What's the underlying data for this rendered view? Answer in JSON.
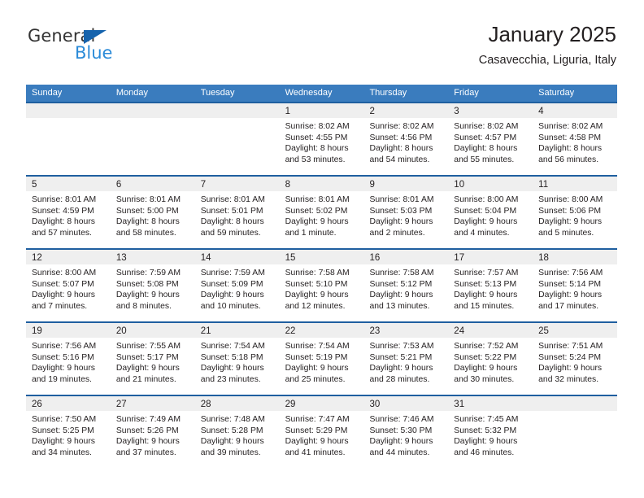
{
  "brand": {
    "name_top": "General",
    "name_bottom": "Blue",
    "triangle_color": "#1563ad",
    "blue_color": "#2b8bd8"
  },
  "header": {
    "title": "January 2025",
    "subtitle": "Casavecchia, Liguria, Italy"
  },
  "theme": {
    "header_blue": "#3a7cbe",
    "row_border_blue": "#1f5fa0",
    "daynum_strip": "#efefef"
  },
  "labels": {
    "sunrise": "Sunrise:",
    "sunset": "Sunset:",
    "daylight": "Daylight:"
  },
  "weekdays": [
    "Sunday",
    "Monday",
    "Tuesday",
    "Wednesday",
    "Thursday",
    "Friday",
    "Saturday"
  ],
  "weeks": [
    [
      {
        "day": "",
        "empty": true
      },
      {
        "day": "",
        "empty": true
      },
      {
        "day": "",
        "empty": true
      },
      {
        "day": "1",
        "sunrise": "Sunrise: 8:02 AM",
        "sunset": "Sunset: 4:55 PM",
        "daylight1": "Daylight: 8 hours",
        "daylight2": "and 53 minutes."
      },
      {
        "day": "2",
        "sunrise": "Sunrise: 8:02 AM",
        "sunset": "Sunset: 4:56 PM",
        "daylight1": "Daylight: 8 hours",
        "daylight2": "and 54 minutes."
      },
      {
        "day": "3",
        "sunrise": "Sunrise: 8:02 AM",
        "sunset": "Sunset: 4:57 PM",
        "daylight1": "Daylight: 8 hours",
        "daylight2": "and 55 minutes."
      },
      {
        "day": "4",
        "sunrise": "Sunrise: 8:02 AM",
        "sunset": "Sunset: 4:58 PM",
        "daylight1": "Daylight: 8 hours",
        "daylight2": "and 56 minutes."
      }
    ],
    [
      {
        "day": "5",
        "sunrise": "Sunrise: 8:01 AM",
        "sunset": "Sunset: 4:59 PM",
        "daylight1": "Daylight: 8 hours",
        "daylight2": "and 57 minutes."
      },
      {
        "day": "6",
        "sunrise": "Sunrise: 8:01 AM",
        "sunset": "Sunset: 5:00 PM",
        "daylight1": "Daylight: 8 hours",
        "daylight2": "and 58 minutes."
      },
      {
        "day": "7",
        "sunrise": "Sunrise: 8:01 AM",
        "sunset": "Sunset: 5:01 PM",
        "daylight1": "Daylight: 8 hours",
        "daylight2": "and 59 minutes."
      },
      {
        "day": "8",
        "sunrise": "Sunrise: 8:01 AM",
        "sunset": "Sunset: 5:02 PM",
        "daylight1": "Daylight: 9 hours",
        "daylight2": "and 1 minute."
      },
      {
        "day": "9",
        "sunrise": "Sunrise: 8:01 AM",
        "sunset": "Sunset: 5:03 PM",
        "daylight1": "Daylight: 9 hours",
        "daylight2": "and 2 minutes."
      },
      {
        "day": "10",
        "sunrise": "Sunrise: 8:00 AM",
        "sunset": "Sunset: 5:04 PM",
        "daylight1": "Daylight: 9 hours",
        "daylight2": "and 4 minutes."
      },
      {
        "day": "11",
        "sunrise": "Sunrise: 8:00 AM",
        "sunset": "Sunset: 5:06 PM",
        "daylight1": "Daylight: 9 hours",
        "daylight2": "and 5 minutes."
      }
    ],
    [
      {
        "day": "12",
        "sunrise": "Sunrise: 8:00 AM",
        "sunset": "Sunset: 5:07 PM",
        "daylight1": "Daylight: 9 hours",
        "daylight2": "and 7 minutes."
      },
      {
        "day": "13",
        "sunrise": "Sunrise: 7:59 AM",
        "sunset": "Sunset: 5:08 PM",
        "daylight1": "Daylight: 9 hours",
        "daylight2": "and 8 minutes."
      },
      {
        "day": "14",
        "sunrise": "Sunrise: 7:59 AM",
        "sunset": "Sunset: 5:09 PM",
        "daylight1": "Daylight: 9 hours",
        "daylight2": "and 10 minutes."
      },
      {
        "day": "15",
        "sunrise": "Sunrise: 7:58 AM",
        "sunset": "Sunset: 5:10 PM",
        "daylight1": "Daylight: 9 hours",
        "daylight2": "and 12 minutes."
      },
      {
        "day": "16",
        "sunrise": "Sunrise: 7:58 AM",
        "sunset": "Sunset: 5:12 PM",
        "daylight1": "Daylight: 9 hours",
        "daylight2": "and 13 minutes."
      },
      {
        "day": "17",
        "sunrise": "Sunrise: 7:57 AM",
        "sunset": "Sunset: 5:13 PM",
        "daylight1": "Daylight: 9 hours",
        "daylight2": "and 15 minutes."
      },
      {
        "day": "18",
        "sunrise": "Sunrise: 7:56 AM",
        "sunset": "Sunset: 5:14 PM",
        "daylight1": "Daylight: 9 hours",
        "daylight2": "and 17 minutes."
      }
    ],
    [
      {
        "day": "19",
        "sunrise": "Sunrise: 7:56 AM",
        "sunset": "Sunset: 5:16 PM",
        "daylight1": "Daylight: 9 hours",
        "daylight2": "and 19 minutes."
      },
      {
        "day": "20",
        "sunrise": "Sunrise: 7:55 AM",
        "sunset": "Sunset: 5:17 PM",
        "daylight1": "Daylight: 9 hours",
        "daylight2": "and 21 minutes."
      },
      {
        "day": "21",
        "sunrise": "Sunrise: 7:54 AM",
        "sunset": "Sunset: 5:18 PM",
        "daylight1": "Daylight: 9 hours",
        "daylight2": "and 23 minutes."
      },
      {
        "day": "22",
        "sunrise": "Sunrise: 7:54 AM",
        "sunset": "Sunset: 5:19 PM",
        "daylight1": "Daylight: 9 hours",
        "daylight2": "and 25 minutes."
      },
      {
        "day": "23",
        "sunrise": "Sunrise: 7:53 AM",
        "sunset": "Sunset: 5:21 PM",
        "daylight1": "Daylight: 9 hours",
        "daylight2": "and 28 minutes."
      },
      {
        "day": "24",
        "sunrise": "Sunrise: 7:52 AM",
        "sunset": "Sunset: 5:22 PM",
        "daylight1": "Daylight: 9 hours",
        "daylight2": "and 30 minutes."
      },
      {
        "day": "25",
        "sunrise": "Sunrise: 7:51 AM",
        "sunset": "Sunset: 5:24 PM",
        "daylight1": "Daylight: 9 hours",
        "daylight2": "and 32 minutes."
      }
    ],
    [
      {
        "day": "26",
        "sunrise": "Sunrise: 7:50 AM",
        "sunset": "Sunset: 5:25 PM",
        "daylight1": "Daylight: 9 hours",
        "daylight2": "and 34 minutes."
      },
      {
        "day": "27",
        "sunrise": "Sunrise: 7:49 AM",
        "sunset": "Sunset: 5:26 PM",
        "daylight1": "Daylight: 9 hours",
        "daylight2": "and 37 minutes."
      },
      {
        "day": "28",
        "sunrise": "Sunrise: 7:48 AM",
        "sunset": "Sunset: 5:28 PM",
        "daylight1": "Daylight: 9 hours",
        "daylight2": "and 39 minutes."
      },
      {
        "day": "29",
        "sunrise": "Sunrise: 7:47 AM",
        "sunset": "Sunset: 5:29 PM",
        "daylight1": "Daylight: 9 hours",
        "daylight2": "and 41 minutes."
      },
      {
        "day": "30",
        "sunrise": "Sunrise: 7:46 AM",
        "sunset": "Sunset: 5:30 PM",
        "daylight1": "Daylight: 9 hours",
        "daylight2": "and 44 minutes."
      },
      {
        "day": "31",
        "sunrise": "Sunrise: 7:45 AM",
        "sunset": "Sunset: 5:32 PM",
        "daylight1": "Daylight: 9 hours",
        "daylight2": "and 46 minutes."
      },
      {
        "day": "",
        "empty": true
      }
    ]
  ]
}
